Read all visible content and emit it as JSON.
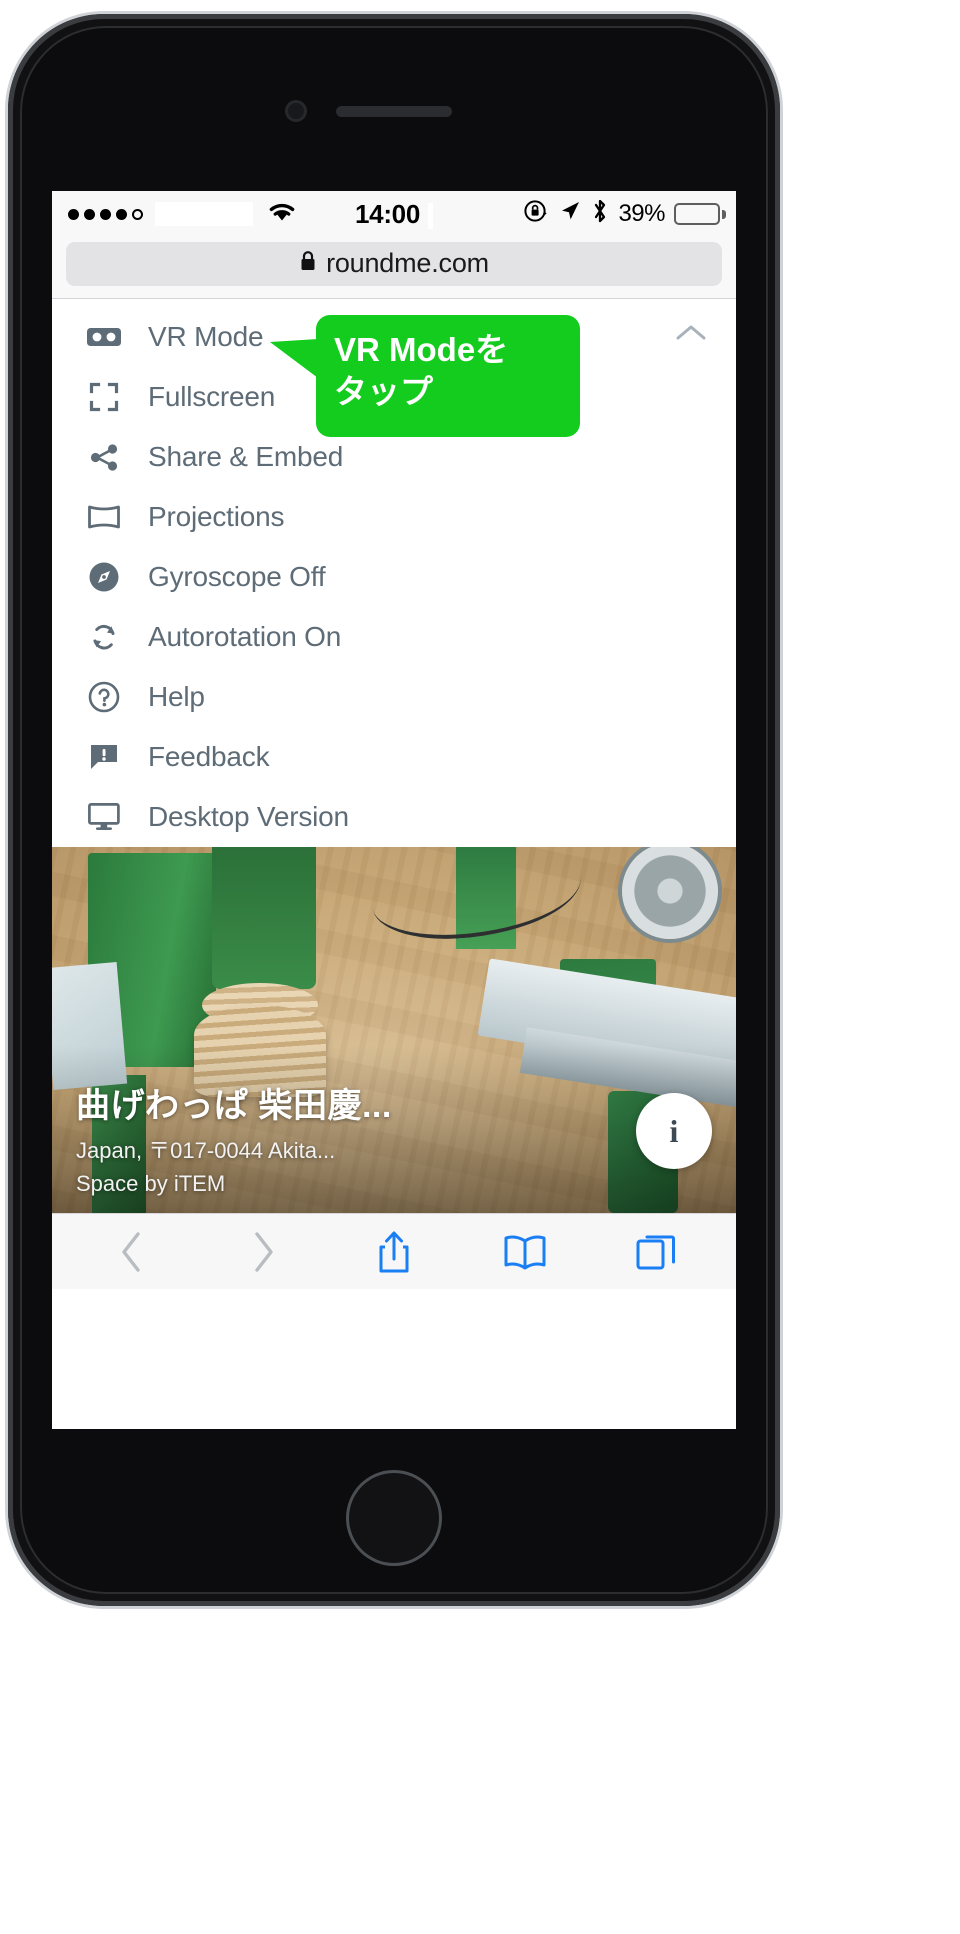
{
  "status_bar": {
    "signal_dots_filled": 4,
    "signal_dots_total": 5,
    "wifi_icon": "wifi-icon",
    "time": "14:00",
    "rotation_lock_icon": "rotation-lock-icon",
    "location_icon": "location-arrow-icon",
    "bluetooth_icon": "bluetooth-icon",
    "battery_percent": "39%",
    "battery_level": 39
  },
  "browser": {
    "lock_icon": "lock-icon",
    "url": "roundme.com",
    "reload_icon": "reload-icon"
  },
  "menu": {
    "collapse_icon": "chevron-up-icon",
    "items": [
      {
        "icon": "vr-goggles-icon",
        "label": "VR Mode"
      },
      {
        "icon": "fullscreen-icon",
        "label": "Fullscreen"
      },
      {
        "icon": "share-icon",
        "label": "Share & Embed"
      },
      {
        "icon": "projections-icon",
        "label": "Projections"
      },
      {
        "icon": "compass-icon",
        "label": "Gyroscope Off"
      },
      {
        "icon": "autorotate-icon",
        "label": "Autorotation On"
      },
      {
        "icon": "question-circle-icon",
        "label": "Help"
      },
      {
        "icon": "feedback-bubble-icon",
        "label": "Feedback"
      },
      {
        "icon": "desktop-monitor-icon",
        "label": "Desktop Version"
      }
    ]
  },
  "callout": {
    "line1": "VR Modeを",
    "line2": "タップ",
    "color": "#14cc1e",
    "text_color": "#ffffff"
  },
  "photo": {
    "title": "曲げわっぱ 柴田慶...",
    "subtitle": "Japan, 〒017-0044 Akita...",
    "author": "Space by iTEM",
    "info_button_label": "i"
  },
  "safari_toolbar": {
    "items": [
      {
        "icon": "back-chevron-icon",
        "label": ""
      },
      {
        "icon": "forward-chevron-icon",
        "label": ""
      },
      {
        "icon": "share-upload-icon",
        "label": ""
      },
      {
        "icon": "bookmarks-book-icon",
        "label": ""
      },
      {
        "icon": "tabs-icon",
        "label": ""
      }
    ],
    "accent_color": "#1a7ef5",
    "disabled_color": "#b9bcc0"
  }
}
